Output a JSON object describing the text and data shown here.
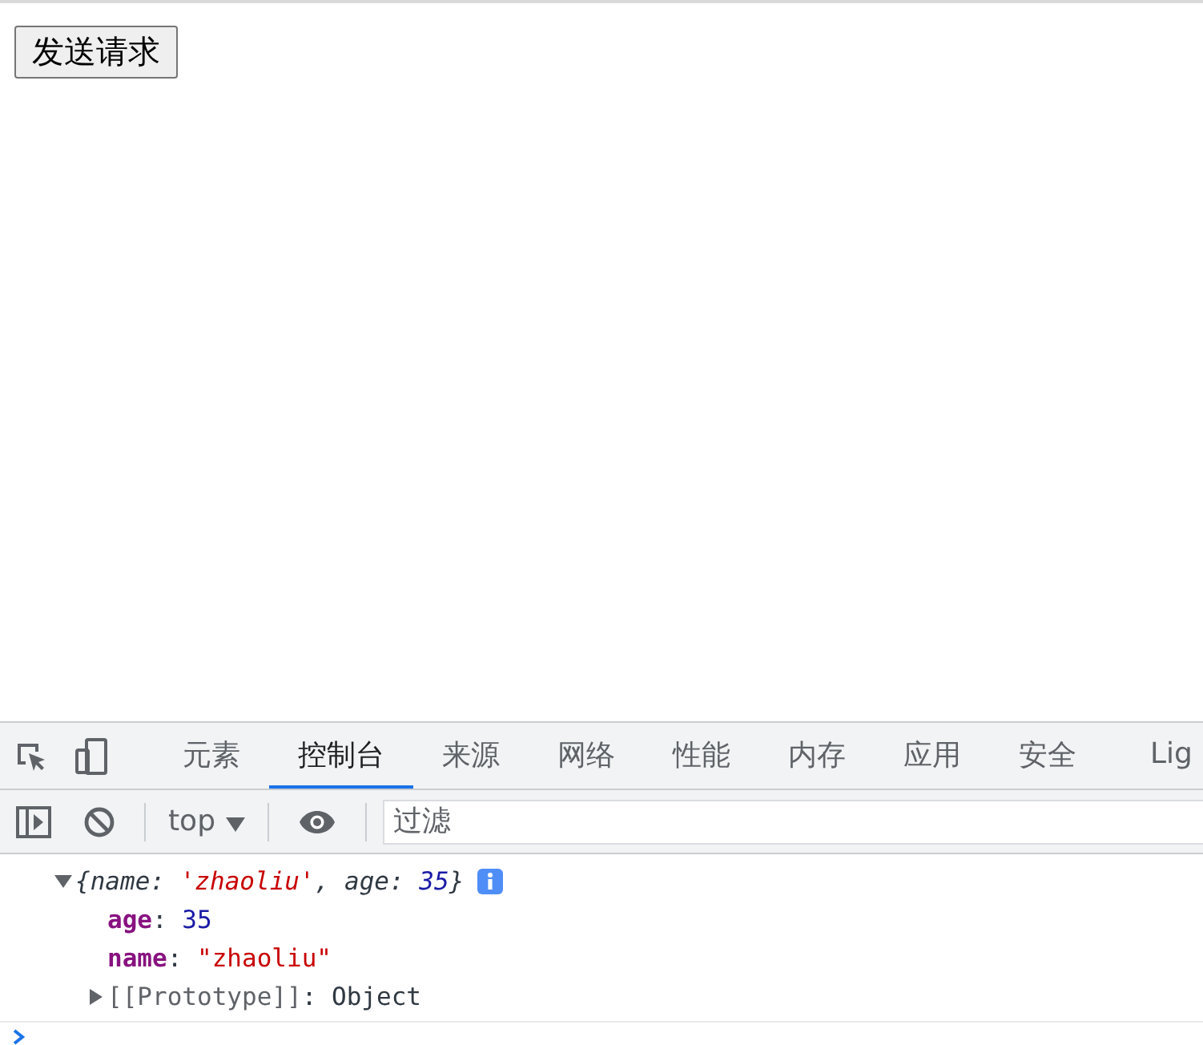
{
  "page": {
    "button": "发送请求"
  },
  "devtools": {
    "tabs": [
      {
        "label": "元素",
        "selected": false
      },
      {
        "label": "控制台",
        "selected": true
      },
      {
        "label": "来源",
        "selected": false
      },
      {
        "label": "网络",
        "selected": false
      },
      {
        "label": "性能",
        "selected": false
      },
      {
        "label": "内存",
        "selected": false
      },
      {
        "label": "应用",
        "selected": false
      },
      {
        "label": "安全",
        "selected": false
      },
      {
        "label": "Lig",
        "selected": false
      }
    ],
    "context": "top",
    "filter": {
      "placeholder": "过滤"
    }
  },
  "console": {
    "object": {
      "expanded": true,
      "preview": [
        {
          "text": "{name: ",
          "kind": "plain"
        },
        {
          "text": "'zhaoliu'",
          "kind": "string"
        },
        {
          "text": ", age: ",
          "kind": "plain"
        },
        {
          "text": "35",
          "kind": "number"
        },
        {
          "text": "}",
          "kind": "plain"
        }
      ],
      "children": [
        {
          "kind": "property",
          "tokens": [
            {
              "text": "age",
              "kind": "key"
            },
            {
              "text": ": ",
              "kind": "plain"
            },
            {
              "text": "35",
              "kind": "number"
            }
          ]
        },
        {
          "kind": "property",
          "tokens": [
            {
              "text": "name",
              "kind": "key"
            },
            {
              "text": ": ",
              "kind": "plain"
            },
            {
              "text": "\"zhaoliu\"",
              "kind": "string"
            }
          ]
        },
        {
          "kind": "prototype",
          "expanded": false,
          "tokens": [
            {
              "text": "[[Prototype]]",
              "kind": "internal"
            },
            {
              "text": ": Object",
              "kind": "plain"
            }
          ]
        }
      ]
    }
  }
}
